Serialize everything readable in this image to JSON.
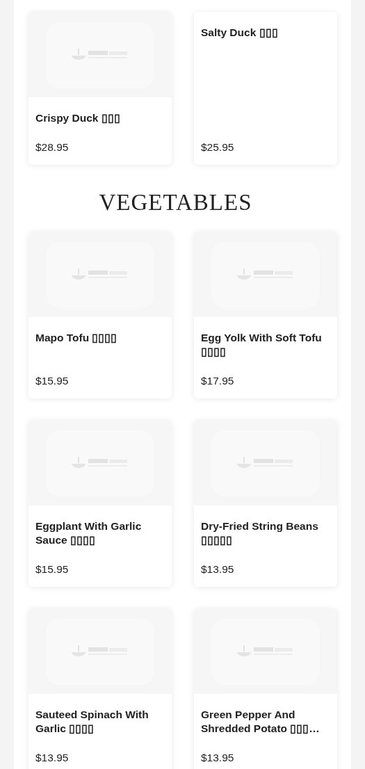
{
  "sections": [
    {
      "items": [
        {
          "name": "Crispy Duck ▯▯▯",
          "price": "$28.95",
          "picture": true
        },
        {
          "name": "Salty Duck ▯▯▯",
          "price": "$25.95",
          "picture": false
        }
      ]
    },
    {
      "heading": "VEGETABLES",
      "items": [
        {
          "name": "Mapo Tofu ▯▯▯▯",
          "price": "$15.95",
          "picture": true
        },
        {
          "name": "Egg Yolk With Soft Tofu ▯▯▯▯",
          "price": "$17.95",
          "picture": true
        },
        {
          "name": "Eggplant With Garlic Sauce ▯▯▯▯",
          "price": "$15.95",
          "picture": true
        },
        {
          "name": "Dry-Fried String Beans ▯▯▯▯▯",
          "price": "$13.95",
          "picture": true
        },
        {
          "name": "Sauteed Spinach With Garlic ▯▯▯▯",
          "price": "$13.95",
          "picture": true
        },
        {
          "name": "Green Pepper And Shredded Potato ▯▯▯…",
          "price": "$13.95",
          "picture": true
        }
      ]
    }
  ]
}
